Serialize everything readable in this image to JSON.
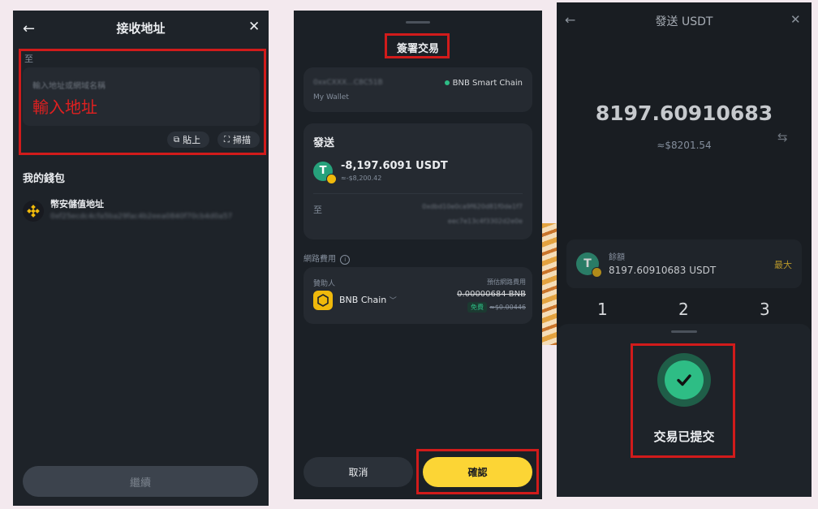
{
  "panel1": {
    "title": "接收地址",
    "to_label": "至",
    "input_placeholder": "輸入地址或網域名稱",
    "input_hint": "輸入地址",
    "paste_label": "貼上",
    "scan_label": "掃描",
    "my_wallet_title": "我的錢包",
    "wallet_name": "幣安儲值地址",
    "wallet_address": "0xf25ecdc4cfa5ba29fac4b2eea0840f70cb4d0a57",
    "continue_label": "繼續"
  },
  "panel2": {
    "title": "簽署交易",
    "wallet_address": "0xxCXXX...C8C51B",
    "wallet_label": "My Wallet",
    "network": "BNB Smart Chain",
    "send_title": "發送",
    "amount": "-8,197.6091 USDT",
    "amount_fiat": "≈-$8,200.42",
    "to_label": "至",
    "to_address_line1": "0xdbd10e0ca9f620d81f0de1f7",
    "to_address_line2": "eec7e13c4f3302d2e0e",
    "fee_title": "網路費用",
    "sponsor_label": "贊助人",
    "chain_name": "BNB Chain",
    "est_fee_label": "預估網路費用",
    "fee_amount": "0.00000684 BNB",
    "free_badge": "免費",
    "fee_fiat": "≈$0.00446",
    "cancel_label": "取消",
    "confirm_label": "確認"
  },
  "panel3": {
    "title": "發送 USDT",
    "amount": "8197.60910683",
    "fiat": "≈$8201.54",
    "balance_label": "餘額",
    "balance_value": "8197.60910683 USDT",
    "max_label": "最大",
    "keys": [
      "1",
      "2",
      "3"
    ],
    "submitted_label": "交易已提交"
  },
  "colors": {
    "panel_bg": "#1e2329",
    "card_bg": "#252a31",
    "accent_yellow": "#fcd535",
    "success_green": "#2ebd85",
    "highlight_red": "#d11b1b"
  }
}
